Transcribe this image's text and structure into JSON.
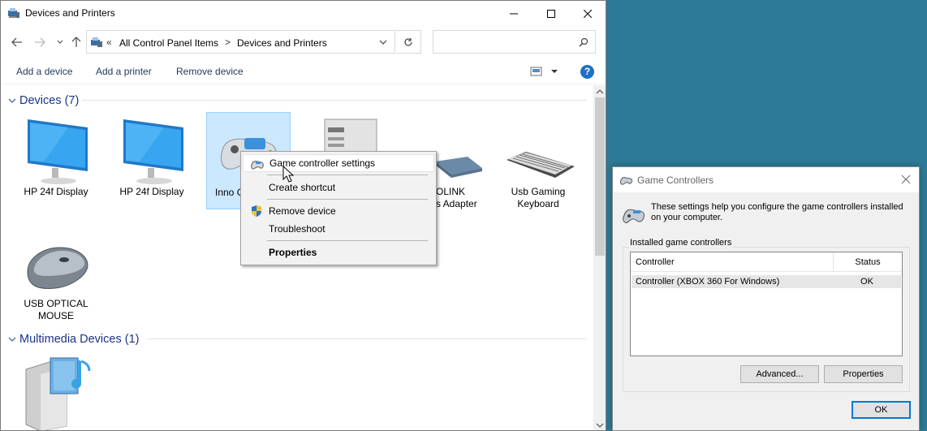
{
  "window": {
    "title": "Devices and Printers"
  },
  "address": {
    "overflow": "«",
    "crumb1": "All Control Panel Items",
    "separator": ">",
    "crumb2": "Devices and Printers",
    "search_placeholder": ""
  },
  "commands": {
    "add_device": "Add a device",
    "add_printer": "Add a printer",
    "remove_device": "Remove device",
    "help": "?"
  },
  "groups": {
    "devices": "Devices (7)",
    "multimedia": "Multimedia Devices (1)"
  },
  "devices": [
    {
      "label": "HP 24f Display",
      "icon": "monitor-icon"
    },
    {
      "label": "HP 24f Display",
      "icon": "monitor-icon"
    },
    {
      "label": "Inno G",
      "icon": "gamepad-icon"
    },
    {
      "label": "",
      "icon": "computer-icon"
    },
    {
      "label": "OLINK\ns Adapter",
      "icon": "network-adapter-icon"
    },
    {
      "label": "Usb Gaming\nKeyboard",
      "icon": "keyboard-icon"
    },
    {
      "label": "USB OPTICAL\nMOUSE",
      "icon": "mouse-icon"
    }
  ],
  "context_menu": {
    "items": [
      {
        "label": "Game controller settings",
        "icon": "gamepad-icon",
        "hover": true
      },
      {
        "label": "Create shortcut"
      },
      {
        "label": "Remove device",
        "icon": "uac-shield-icon"
      },
      {
        "label": "Troubleshoot"
      },
      {
        "label": "Properties",
        "bold": true
      }
    ]
  },
  "game_controllers": {
    "title": "Game Controllers",
    "description": "These settings help you configure the game controllers installed on your computer.",
    "group_label": "Installed game controllers",
    "columns": [
      "Controller",
      "Status"
    ],
    "rows": [
      {
        "controller": "Controller (XBOX 360 For Windows)",
        "status": "OK"
      }
    ],
    "buttons": {
      "advanced": "Advanced...",
      "properties": "Properties",
      "ok": "OK"
    }
  },
  "colors": {
    "desktop": "#2c7a95",
    "link_text": "#1e395b",
    "group_header": "#1e3287",
    "selection": "#cce8ff",
    "accent": "#0078d7"
  }
}
